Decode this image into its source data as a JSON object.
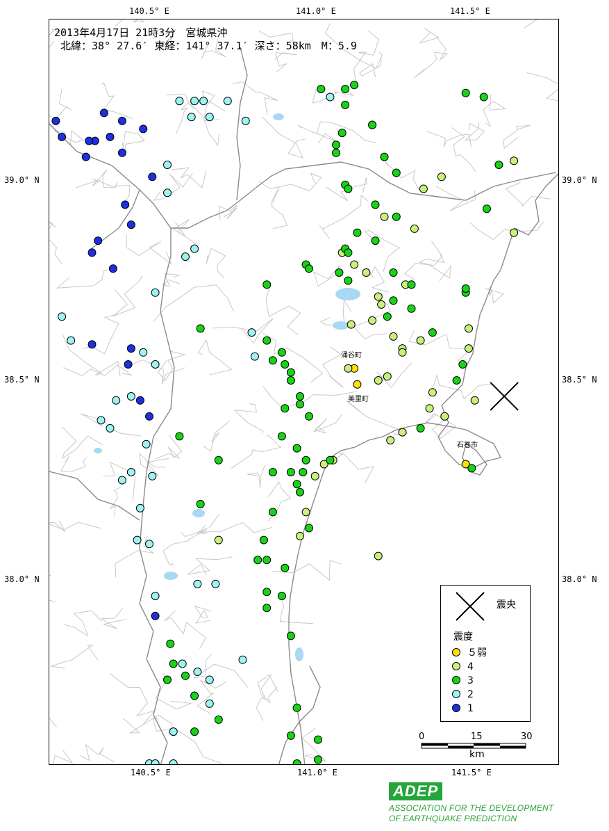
{
  "header": {
    "line1": "2013年4月17日 21時3分　宮城県沖",
    "line2": " 北緯：38° 27.6′ 東経：141° 37.1′ 深さ：58km　M：5.9"
  },
  "axes": {
    "lon_labels": [
      "140.5° E",
      "141.0° E",
      "141.5° E"
    ],
    "lat_labels": [
      "39.0° N",
      "38.5° N",
      "38.0° N"
    ]
  },
  "places": [
    "涌谷町",
    "美里町",
    "石巻市"
  ],
  "legend": {
    "epicenter_label": "震央",
    "title": "震度",
    "items": [
      {
        "label": "５弱",
        "color": "#ffe000"
      },
      {
        "label": "4",
        "color": "#c8f07a"
      },
      {
        "label": "3",
        "color": "#16d416"
      },
      {
        "label": "2",
        "color": "#9cf4ef"
      },
      {
        "label": "1",
        "color": "#1f2fe0"
      }
    ]
  },
  "scale": {
    "ticks": [
      "0",
      "15",
      "30"
    ],
    "unit": "km"
  },
  "logo": {
    "mark": "ADEP",
    "line1": "ASSOCIATION FOR THE DEVELOPMENT",
    "line2": "OF EARTHQUAKE PREDICTION"
  },
  "map_data": {
    "epicenter": {
      "lat": 38.46,
      "lon": 141.618
    },
    "stations": [
      [
        39.11,
        140.15,
        1
      ],
      [
        39.17,
        140.29,
        1
      ],
      [
        39.15,
        140.13,
        1
      ],
      [
        39.15,
        140.35,
        1
      ],
      [
        39.13,
        140.42,
        1
      ],
      [
        39.1,
        140.26,
        1
      ],
      [
        39.1,
        140.24,
        1
      ],
      [
        39.11,
        140.31,
        1
      ],
      [
        39.07,
        140.35,
        1
      ],
      [
        39.06,
        140.23,
        1
      ],
      [
        39.01,
        140.45,
        1
      ],
      [
        38.94,
        140.36,
        1
      ],
      [
        38.89,
        140.38,
        1
      ],
      [
        38.85,
        140.27,
        1
      ],
      [
        38.82,
        140.25,
        1
      ],
      [
        38.78,
        140.32,
        1
      ],
      [
        38.58,
        140.38,
        1
      ],
      [
        38.59,
        140.25,
        1
      ],
      [
        38.54,
        140.37,
        1
      ],
      [
        38.45,
        140.41,
        1
      ],
      [
        38.41,
        140.44,
        1
      ],
      [
        37.91,
        140.46,
        1
      ],
      [
        39.2,
        140.59,
        2
      ],
      [
        39.2,
        140.54,
        2
      ],
      [
        39.2,
        140.62,
        2
      ],
      [
        39.16,
        140.64,
        2
      ],
      [
        39.15,
        140.76,
        2
      ],
      [
        39.04,
        140.5,
        2
      ],
      [
        38.97,
        140.5,
        2
      ],
      [
        38.81,
        140.56,
        2
      ],
      [
        38.72,
        140.46,
        2
      ],
      [
        38.57,
        140.42,
        2
      ],
      [
        38.54,
        140.46,
        2
      ],
      [
        38.46,
        140.38,
        2
      ],
      [
        38.34,
        140.43,
        2
      ],
      [
        38.27,
        140.38,
        2
      ],
      [
        38.26,
        140.45,
        2
      ],
      [
        38.18,
        140.41,
        2
      ],
      [
        38.1,
        140.4,
        2
      ],
      [
        38.09,
        140.44,
        2
      ],
      [
        37.96,
        140.46,
        2
      ],
      [
        38.66,
        140.15,
        2
      ],
      [
        38.6,
        140.18,
        2
      ],
      [
        38.45,
        140.33,
        2
      ],
      [
        38.4,
        140.28,
        2
      ],
      [
        38.38,
        140.31,
        2
      ],
      [
        38.25,
        140.35,
        2
      ],
      [
        37.99,
        140.66,
        2
      ],
      [
        37.99,
        140.6,
        2
      ],
      [
        37.8,
        140.75,
        2
      ],
      [
        37.79,
        140.55,
        2
      ],
      [
        37.77,
        140.6,
        2
      ],
      [
        37.75,
        140.64,
        2
      ],
      [
        37.69,
        140.64,
        2
      ],
      [
        37.62,
        140.52,
        2
      ],
      [
        37.54,
        140.52,
        2
      ],
      [
        38.62,
        140.78,
        2
      ],
      [
        38.56,
        140.79,
        2
      ],
      [
        38.83,
        140.59,
        2
      ],
      [
        39.16,
        140.58,
        2
      ],
      [
        39.21,
        141.04,
        2
      ],
      [
        39.2,
        140.7,
        2
      ],
      [
        37.54,
        140.44,
        2
      ],
      [
        37.54,
        140.46,
        2
      ],
      [
        38.53,
        141.12,
        "5-"
      ],
      [
        38.49,
        141.13,
        "5-"
      ],
      [
        38.29,
        141.49,
        "5-"
      ],
      [
        39.01,
        141.41,
        4
      ],
      [
        38.98,
        141.35,
        4
      ],
      [
        38.91,
        141.22,
        4
      ],
      [
        38.88,
        141.32,
        4
      ],
      [
        38.82,
        141.08,
        4
      ],
      [
        38.79,
        141.12,
        4
      ],
      [
        38.77,
        141.16,
        4
      ],
      [
        38.74,
        141.29,
        4
      ],
      [
        38.71,
        141.2,
        4
      ],
      [
        38.69,
        141.21,
        4
      ],
      [
        38.65,
        141.18,
        4
      ],
      [
        38.64,
        141.11,
        4
      ],
      [
        38.61,
        141.25,
        4
      ],
      [
        38.6,
        141.34,
        4
      ],
      [
        38.58,
        141.28,
        4
      ],
      [
        38.57,
        141.28,
        4
      ],
      [
        38.53,
        141.1,
        4
      ],
      [
        38.51,
        141.23,
        4
      ],
      [
        38.5,
        141.2,
        4
      ],
      [
        38.47,
        141.38,
        4
      ],
      [
        38.45,
        141.52,
        4
      ],
      [
        38.43,
        141.37,
        4
      ],
      [
        38.41,
        141.42,
        4
      ],
      [
        38.37,
        141.28,
        4
      ],
      [
        38.35,
        141.24,
        4
      ],
      [
        38.3,
        141.05,
        4
      ],
      [
        38.29,
        141.02,
        4
      ],
      [
        38.26,
        140.99,
        4
      ],
      [
        38.17,
        140.96,
        4
      ],
      [
        38.11,
        140.94,
        4
      ],
      [
        38.1,
        140.67,
        4
      ],
      [
        38.06,
        141.2,
        4
      ],
      [
        39.05,
        141.65,
        4
      ],
      [
        38.87,
        141.65,
        4
      ],
      [
        38.63,
        141.5,
        4
      ],
      [
        38.58,
        141.5,
        4
      ],
      [
        39.23,
        141.01,
        3
      ],
      [
        39.23,
        141.09,
        3
      ],
      [
        39.24,
        141.12,
        3
      ],
      [
        39.21,
        141.55,
        3
      ],
      [
        39.19,
        141.09,
        3
      ],
      [
        39.14,
        141.18,
        3
      ],
      [
        39.12,
        141.08,
        3
      ],
      [
        39.09,
        141.06,
        3
      ],
      [
        39.07,
        141.06,
        3
      ],
      [
        39.06,
        141.22,
        3
      ],
      [
        39.02,
        141.26,
        3
      ],
      [
        38.99,
        141.09,
        3
      ],
      [
        38.98,
        141.1,
        3
      ],
      [
        38.94,
        141.19,
        3
      ],
      [
        38.91,
        141.26,
        3
      ],
      [
        38.87,
        141.13,
        3
      ],
      [
        38.83,
        141.09,
        3
      ],
      [
        38.82,
        141.1,
        3
      ],
      [
        38.79,
        140.96,
        3
      ],
      [
        38.78,
        140.97,
        3
      ],
      [
        38.77,
        141.07,
        3
      ],
      [
        38.77,
        141.25,
        3
      ],
      [
        38.74,
        141.31,
        3
      ],
      [
        38.72,
        141.49,
        3
      ],
      [
        38.7,
        141.25,
        3
      ],
      [
        38.68,
        141.31,
        3
      ],
      [
        38.66,
        141.23,
        3
      ],
      [
        38.62,
        141.38,
        3
      ],
      [
        38.6,
        140.83,
        3
      ],
      [
        38.57,
        140.88,
        3
      ],
      [
        38.55,
        140.85,
        3
      ],
      [
        38.54,
        140.89,
        3
      ],
      [
        38.52,
        140.91,
        3
      ],
      [
        38.5,
        140.91,
        3
      ],
      [
        38.5,
        141.46,
        3
      ],
      [
        38.46,
        140.94,
        3
      ],
      [
        38.44,
        140.94,
        3
      ],
      [
        38.43,
        140.89,
        3
      ],
      [
        38.41,
        140.97,
        3
      ],
      [
        38.38,
        141.34,
        3
      ],
      [
        38.36,
        140.88,
        3
      ],
      [
        38.33,
        140.93,
        3
      ],
      [
        38.3,
        140.96,
        3
      ],
      [
        38.3,
        141.04,
        3
      ],
      [
        38.27,
        140.85,
        3
      ],
      [
        38.27,
        140.91,
        3
      ],
      [
        38.27,
        140.95,
        3
      ],
      [
        38.24,
        140.93,
        3
      ],
      [
        38.22,
        140.94,
        3
      ],
      [
        38.17,
        140.85,
        3
      ],
      [
        38.13,
        140.97,
        3
      ],
      [
        38.1,
        140.82,
        3
      ],
      [
        38.05,
        140.8,
        3
      ],
      [
        38.05,
        140.83,
        3
      ],
      [
        38.03,
        140.89,
        3
      ],
      [
        37.97,
        140.83,
        3
      ],
      [
        37.96,
        140.88,
        3
      ],
      [
        37.93,
        140.83,
        3
      ],
      [
        37.86,
        140.91,
        3
      ],
      [
        37.84,
        140.51,
        3
      ],
      [
        37.79,
        140.52,
        3
      ],
      [
        37.76,
        140.56,
        3
      ],
      [
        37.75,
        140.5,
        3
      ],
      [
        37.71,
        140.59,
        3
      ],
      [
        37.68,
        140.93,
        3
      ],
      [
        37.65,
        140.67,
        3
      ],
      [
        37.62,
        140.59,
        3
      ],
      [
        37.61,
        140.91,
        3
      ],
      [
        37.6,
        141.0,
        3
      ],
      [
        37.55,
        141.0,
        3
      ],
      [
        37.54,
        140.93,
        3
      ],
      [
        38.36,
        140.54,
        3
      ],
      [
        38.3,
        140.67,
        3
      ],
      [
        38.19,
        140.61,
        3
      ],
      [
        38.54,
        141.48,
        3
      ],
      [
        39.04,
        141.6,
        3
      ],
      [
        38.93,
        141.56,
        3
      ],
      [
        39.22,
        141.49,
        3
      ],
      [
        39.14,
        141.18,
        3
      ],
      [
        38.28,
        141.51,
        3
      ],
      [
        38.63,
        140.61,
        3
      ],
      [
        38.75,
        141.1,
        3
      ],
      [
        38.74,
        140.83,
        3
      ],
      [
        38.85,
        141.19,
        3
      ],
      [
        38.73,
        141.49,
        3
      ]
    ]
  }
}
